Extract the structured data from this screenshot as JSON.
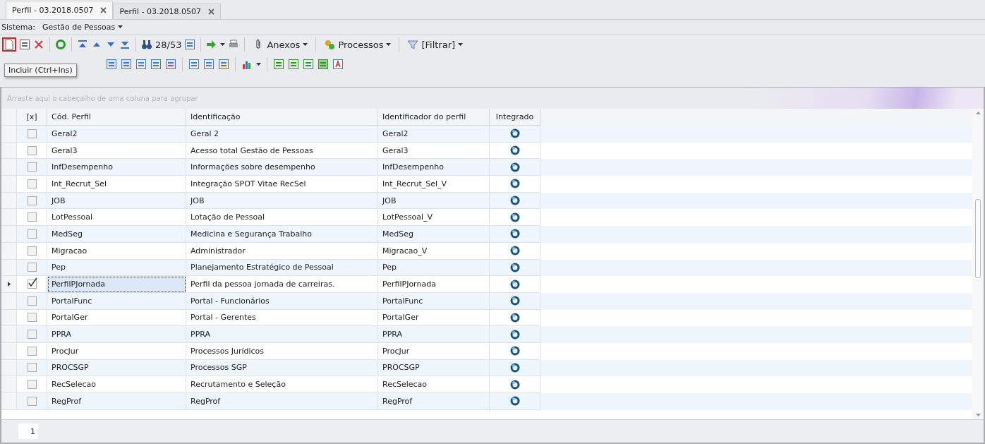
{
  "tabs": [
    {
      "label": "Perfil - 03.2018.0507",
      "selected": true
    },
    {
      "label": "Perfil - 03.2018.0507",
      "selected": false
    }
  ],
  "system": {
    "label": "Sistema:",
    "value": "Gestão de Pessoas"
  },
  "toolbar": {
    "counter": "28/53",
    "menus": [
      "Anexos",
      "Processos",
      "[Filtrar]"
    ]
  },
  "tooltip": "Incluir (Ctrl+Ins)",
  "group_panel": {
    "placeholder": "Arraste aqui o cabeçalho de uma coluna para agrupar"
  },
  "table": {
    "columns": [
      "[x]",
      "Cód. Perfil",
      "Identificação",
      "Identificador do perfil",
      "Integrado"
    ],
    "rows": [
      {
        "checked": false,
        "selected": false,
        "code": "Geral2",
        "identification": "Geral 2",
        "identifier": "Geral2",
        "integrated": true
      },
      {
        "checked": false,
        "selected": false,
        "code": "Geral3",
        "identification": "Acesso total Gestão de Pessoas",
        "identifier": "Geral3",
        "integrated": true
      },
      {
        "checked": false,
        "selected": false,
        "code": "InfDesempenho",
        "identification": "Informações sobre desempenho",
        "identifier": "InfDesempenho",
        "integrated": true
      },
      {
        "checked": false,
        "selected": false,
        "code": "Int_Recrut_Sel",
        "identification": "Integração SPOT Vitae RecSel",
        "identifier": "Int_Recrut_Sel_V",
        "integrated": true
      },
      {
        "checked": false,
        "selected": false,
        "code": "JOB",
        "identification": "JOB",
        "identifier": "JOB",
        "integrated": true
      },
      {
        "checked": false,
        "selected": false,
        "code": "LotPessoal",
        "identification": "Lotação de Pessoal",
        "identifier": "LotPessoal_V",
        "integrated": true
      },
      {
        "checked": false,
        "selected": false,
        "code": "MedSeg",
        "identification": "Medicina e Segurança Trabalho",
        "identifier": "MedSeg",
        "integrated": true
      },
      {
        "checked": false,
        "selected": false,
        "code": "Migracao",
        "identification": "Administrador",
        "identifier": "Migracao_V",
        "integrated": true
      },
      {
        "checked": false,
        "selected": false,
        "code": "Pep",
        "identification": "Planejamento Estratégico de Pessoal",
        "identifier": "Pep",
        "integrated": true
      },
      {
        "checked": true,
        "selected": true,
        "code": "PerfilPJornada",
        "identification": "Perfil da pessoa jornada de carreiras.",
        "identifier": "PerfilPJornada",
        "integrated": true
      },
      {
        "checked": false,
        "selected": false,
        "code": "PortalFunc",
        "identification": "Portal - Funcionários",
        "identifier": "PortalFunc",
        "integrated": true
      },
      {
        "checked": false,
        "selected": false,
        "code": "PortalGer",
        "identification": "Portal - Gerentes",
        "identifier": "PortalGer",
        "integrated": true
      },
      {
        "checked": false,
        "selected": false,
        "code": "PPRA",
        "identification": "PPRA",
        "identifier": "PPRA",
        "integrated": true
      },
      {
        "checked": false,
        "selected": false,
        "code": "ProcJur",
        "identification": "Processos Jurídicos",
        "identifier": "ProcJur",
        "integrated": true
      },
      {
        "checked": false,
        "selected": false,
        "code": "PROCSGP",
        "identification": "Processos SGP",
        "identifier": "PROCSGP",
        "integrated": true
      },
      {
        "checked": false,
        "selected": false,
        "code": "RecSelecao",
        "identification": "Recrutamento e Seleção",
        "identifier": "RecSelecao",
        "integrated": true
      },
      {
        "checked": false,
        "selected": false,
        "code": "RegProf",
        "identification": "RegProf",
        "identifier": "RegProf",
        "integrated": true
      }
    ]
  },
  "footer": {
    "page": "1"
  }
}
